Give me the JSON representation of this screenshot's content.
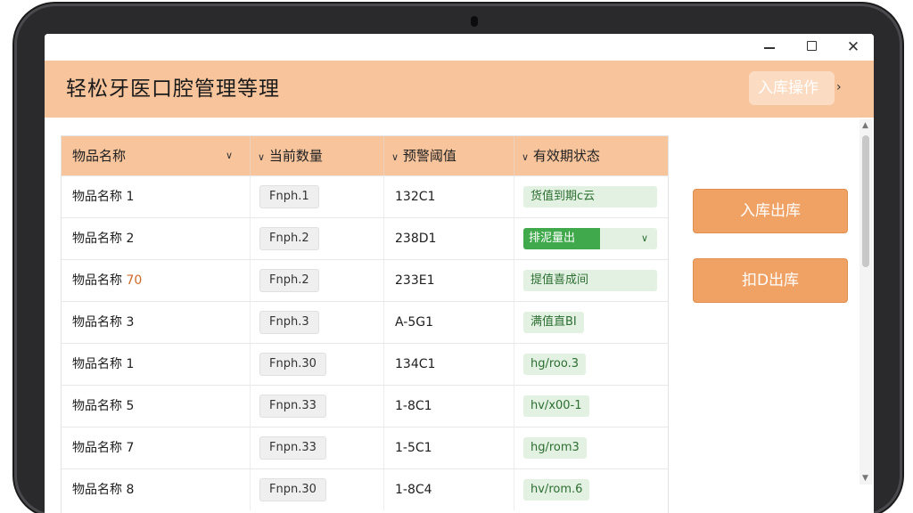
{
  "app": {
    "title": "轻松牙医口腔管理等理",
    "header_action_label": "入库操作"
  },
  "window": {
    "min_glyph": "",
    "max_glyph": "",
    "close_glyph": "✕"
  },
  "table": {
    "columns": [
      {
        "label": "物品名称",
        "caret": "∨"
      },
      {
        "label": "当前数量",
        "caret": "∨"
      },
      {
        "label": "预警阈值",
        "caret": "∨"
      },
      {
        "label": "有效期状态",
        "caret": "∨"
      }
    ],
    "rows": [
      {
        "name": "物品名称 1",
        "name_suffix": "",
        "qty": "Fnph.1",
        "threshold": "132C1",
        "status": "货值到期c云"
      },
      {
        "name": "物品名称 2",
        "name_suffix": "",
        "qty": "Fnph.2",
        "threshold": "238D1",
        "status": "排泥量出",
        "status_select": true
      },
      {
        "name": "物品名称 ",
        "name_suffix": "70",
        "qty": "Fnph.2",
        "threshold": "233E1",
        "status": "提值喜成间"
      },
      {
        "name": "物品名称 3",
        "name_suffix": "",
        "qty": "Fnph.3",
        "threshold": "A-5G1",
        "status": "满值直BI"
      },
      {
        "name": "物品名称 1",
        "name_suffix": "",
        "qty": "Fnph.30",
        "threshold": "134C1",
        "status": "hg/roo.3"
      },
      {
        "name": "物品名称 5",
        "name_suffix": "",
        "qty": "Fnpn.33",
        "threshold": "1-8C1",
        "status": "hv/x00-1"
      },
      {
        "name": "物品名称 7",
        "name_suffix": "",
        "qty": "Fnpn.33",
        "threshold": "1-5C1",
        "status": "hg/rom3"
      },
      {
        "name": "物品名称 8",
        "name_suffix": "",
        "qty": "Fnpn.30",
        "threshold": "1-8C4",
        "status": "hv/rom.6"
      }
    ]
  },
  "actions": {
    "stock_in_out": "入库出库",
    "stock_out": "扣D出库"
  },
  "colors": {
    "header": "#f7c49c",
    "button": "#f0a264",
    "status_green": "#3fa94b",
    "status_bg": "#e2f1e1"
  }
}
